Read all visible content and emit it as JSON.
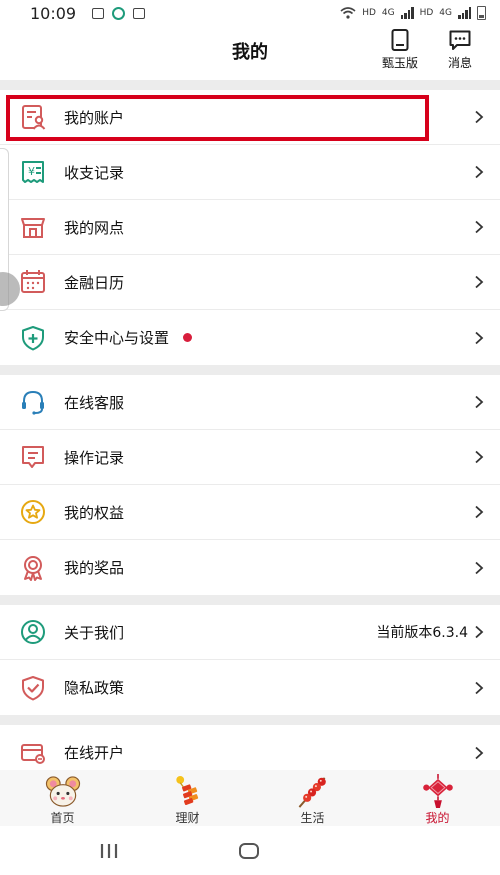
{
  "status_bar": {
    "time": "10:09",
    "hd1": "HD",
    "g1": "4G",
    "hd2": "HD",
    "g2": "4G"
  },
  "header": {
    "title": "我的",
    "zhenyu_label": "甄玉版",
    "message_label": "消息"
  },
  "menu_groups": [
    [
      {
        "label": "我的账户",
        "icon": "account-icon"
      },
      {
        "label": "收支记录",
        "icon": "receipt-icon"
      },
      {
        "label": "我的网点",
        "icon": "branch-store-icon"
      },
      {
        "label": "金融日历",
        "icon": "calendar-icon"
      },
      {
        "label": "安全中心与设置",
        "icon": "security-shield-icon"
      }
    ],
    [
      {
        "label": "在线客服",
        "icon": "headset-icon"
      },
      {
        "label": "操作记录",
        "icon": "operation-record-icon"
      },
      {
        "label": "我的权益",
        "icon": "star-badge-icon"
      },
      {
        "label": "我的奖品",
        "icon": "award-ribbon-icon"
      }
    ],
    [
      {
        "label": "关于我们",
        "icon": "user-circle-icon",
        "extra": "当前版本6.3.4"
      },
      {
        "label": "隐私政策",
        "icon": "privacy-shield-icon"
      }
    ],
    [
      {
        "label": "在线开户",
        "icon": "open-account-card-icon"
      }
    ]
  ],
  "tabs": [
    {
      "label": "首页",
      "icon": "mouse-mascot-icon"
    },
    {
      "label": "理财",
      "icon": "firecracker-icon"
    },
    {
      "label": "生活",
      "icon": "candied-haws-icon"
    },
    {
      "label": "我的",
      "icon": "chinese-knot-icon",
      "active": true
    }
  ],
  "colors": {
    "accent_red": "#c8102e",
    "highlight_box": "#d7001b",
    "icon_red": "#d25b5b",
    "icon_green": "#1e9b7b",
    "icon_blue": "#2a7fb8",
    "icon_gold": "#e6a812"
  }
}
